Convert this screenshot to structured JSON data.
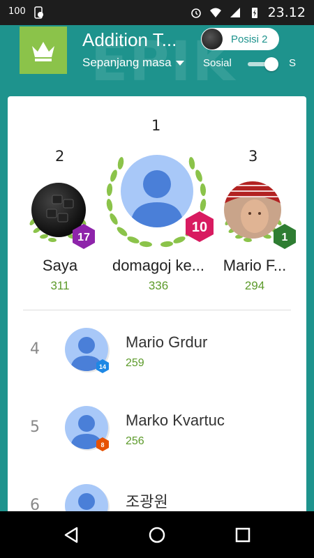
{
  "status_bar": {
    "left_icons": [
      "signal-100-icon",
      "phone-check-icon"
    ],
    "left_text": "100",
    "time": "23.12",
    "right_icons": [
      "alarm-icon",
      "wifi-icon",
      "cell-signal-icon",
      "battery-charging-icon"
    ]
  },
  "header": {
    "title": "Addition T...",
    "period": "Sepanjang masa",
    "social_label": "Sosial",
    "cut_label": "S",
    "position_chip": "Posisi 2",
    "toggle_on": true,
    "watermark": "EPIK"
  },
  "podium": [
    {
      "rank": "2",
      "name": "Saya",
      "score": "311",
      "level": "17",
      "level_color": "#8e24aa"
    },
    {
      "rank": "1",
      "name": "domagoj ke...",
      "score": "336",
      "level": "10",
      "level_color": "#d81b60"
    },
    {
      "rank": "3",
      "name": "Mario F...",
      "score": "294",
      "level": "1",
      "level_color": "#2e7d32"
    }
  ],
  "rows": [
    {
      "rank": "4",
      "name": "Mario Grdur",
      "score": "259",
      "level": "14",
      "level_color": "#1e88e5"
    },
    {
      "rank": "5",
      "name": "Marko Kvartuc",
      "score": "256",
      "level": "8",
      "level_color": "#e65100"
    },
    {
      "rank": "6",
      "name": "조광원",
      "score": "",
      "level": "",
      "level_color": "#1e88e5"
    }
  ],
  "nav": {
    "back": "back-icon",
    "home": "home-icon",
    "recents": "recents-icon"
  },
  "colors": {
    "teal": "#1e938d",
    "score_green": "#5c9a2a",
    "icon_green": "#8bc34a"
  }
}
